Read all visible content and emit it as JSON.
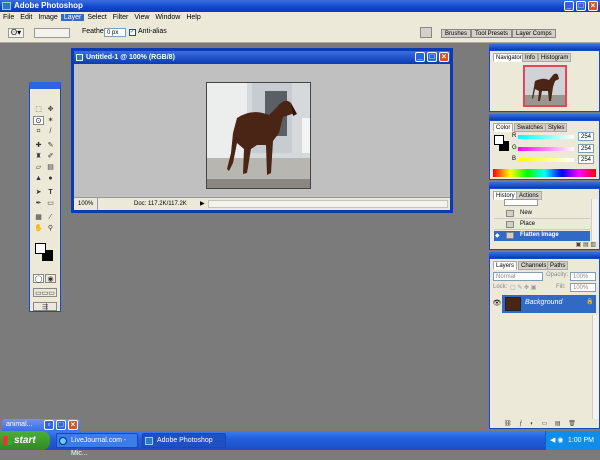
{
  "app": {
    "title": "Adobe Photoshop"
  },
  "menu": [
    "File",
    "Edit",
    "Image",
    "Layer",
    "Select",
    "Filter",
    "View",
    "Window",
    "Help"
  ],
  "menu_selected": "Layer",
  "options": {
    "feather_label": "Feather:",
    "feather_value": "0 px",
    "antialias_label": "Anti-alias"
  },
  "wells": [
    "Brushes",
    "Tool Presets",
    "Layer Comps"
  ],
  "document": {
    "title": "Untitled-1 @ 100% (RGB/8)",
    "zoom": "100%",
    "doc_info": "Doc: 117.2K/117.2K"
  },
  "navigator": {
    "tabs": [
      "Navigator",
      "Info",
      "Histogram"
    ]
  },
  "color": {
    "tabs": [
      "Color",
      "Swatches",
      "Styles"
    ],
    "r_label": "R",
    "g_label": "G",
    "b_label": "B",
    "r": "254",
    "g": "254",
    "b": "254"
  },
  "history": {
    "tabs": [
      "History",
      "Actions"
    ],
    "items": [
      "New",
      "Place",
      "Flatten Image"
    ]
  },
  "layers": {
    "tabs": [
      "Layers",
      "Channels",
      "Paths"
    ],
    "blend": "Normal",
    "opacity_label": "Opacity:",
    "opacity": "100%",
    "lock_label": "Lock:",
    "fill_label": "Fill:",
    "fill": "100%",
    "layer_name": "Background"
  },
  "minimized": {
    "title": "animal..."
  },
  "taskbar": {
    "start": "start",
    "items": [
      "LiveJournal.com - Mic...",
      "Adobe Photoshop"
    ],
    "clock": "1:00 PM"
  },
  "colors": {
    "accent": "#0a3bb5",
    "panel": "#ece9d8",
    "desktop": "#7b7b7b",
    "selection": "#316ac5"
  }
}
